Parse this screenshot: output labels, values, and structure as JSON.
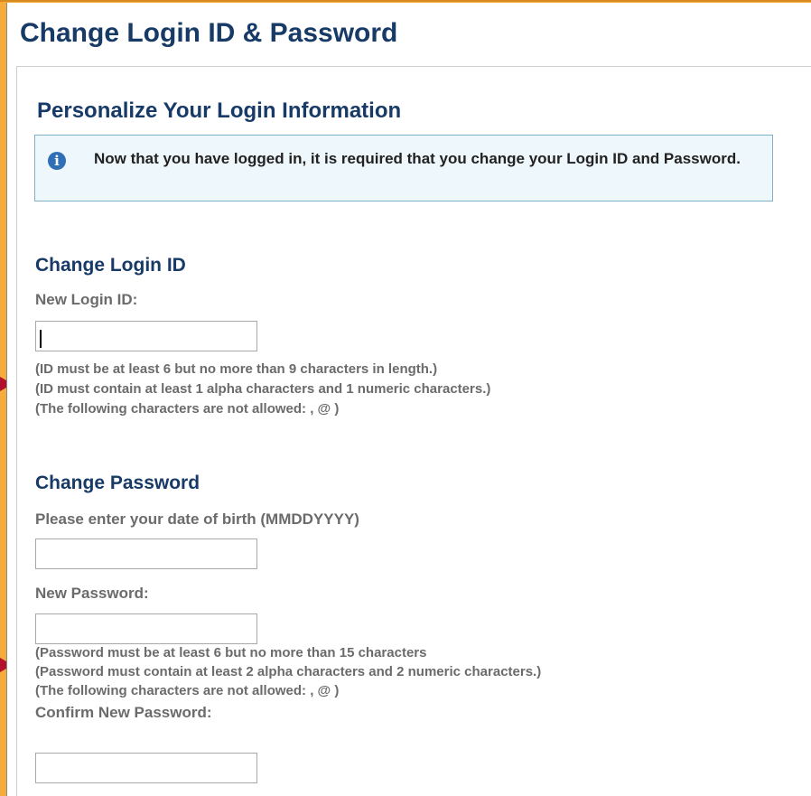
{
  "page": {
    "title": "Change Login ID & Password",
    "section_title": "Personalize Your Login Information"
  },
  "notice": {
    "icon": "info-icon",
    "glyph": "i",
    "text": "Now that you have logged in, it is required that you change your Login ID and Password."
  },
  "login_id": {
    "heading": "Change Login ID",
    "label": "New Login ID:",
    "value": "",
    "hints": [
      "(ID must be at least 6 but no more than 9 characters in length.)",
      "(ID must contain at least 1 alpha characters and 1 numeric characters.)",
      "(The following characters are not allowed: , @ )"
    ]
  },
  "password": {
    "heading": "Change Password",
    "dob_label": "Please enter your date of birth (MMDDYYYY)",
    "dob_value": "",
    "new_label": "New Password:",
    "new_value": "",
    "hints": [
      "(Password must be at least 6 but no more than 15 characters",
      "(Password must contain at least 2 alpha characters and 2 numeric characters.)",
      "(The following characters are not allowed: , @ )"
    ],
    "confirm_label": "Confirm New Password:",
    "confirm_value": ""
  },
  "colors": {
    "heading": "#173a66",
    "frame": "#f5ac3c",
    "info_bg": "#eef7fb",
    "arrow": "#b3102b"
  }
}
